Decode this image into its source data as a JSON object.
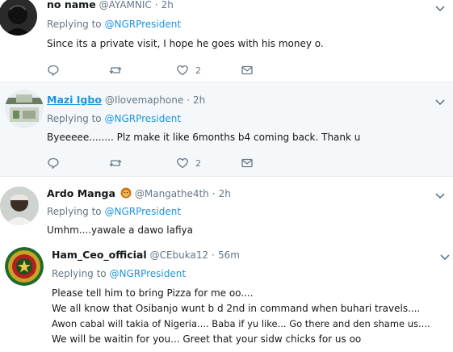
{
  "tweets": [
    {
      "name": "no name",
      "handle": "@AYAMNIC",
      "separator": "·",
      "time": "2h",
      "replying_label": "Replying to",
      "replying_handle": "@NGRPresident",
      "text": [
        "Since its a private visit, I hope he goes with his money o."
      ],
      "likes": "2"
    },
    {
      "name": "Mazi Igbo",
      "handle": "@Ilovemaphone",
      "separator": "·",
      "time": "2h",
      "replying_label": "Replying to",
      "replying_handle": "@NGRPresident",
      "text": [
        "Byeeeee........ Plz make it like 6months b4 coming back. Thank u"
      ],
      "likes": "2"
    },
    {
      "name": "Ardo Manga",
      "emoji": "lion-face-icon",
      "handle": "@Mangathe4th",
      "separator": "·",
      "time": "2h",
      "replying_label": "Replying to",
      "replying_handle": "@NGRPresident",
      "text": [
        "Umhm....yawale a dawo lafiya"
      ]
    },
    {
      "name": "Ham_Ceo_official",
      "handle": "@CEbuka12",
      "separator": "·",
      "time": "56m",
      "replying_label": "Replying to",
      "replying_handle": "@NGRPresident",
      "text": [
        "Please tell him to bring Pizza for me oo....",
        "We all know that Osibanjo wunt b d 2nd in command when buhari travels....",
        "Awon cabal will takia of Nigeria.... Baba if yu like... Go there and den shame us....",
        "We will be waitin for you... Greet that your sidw chicks for us oo"
      ],
      "avatar_lettering": "NIGERIAN ARMY"
    }
  ],
  "icons": {
    "reply": "reply-icon",
    "retweet": "retweet-icon",
    "like": "heart-icon",
    "dm": "envelope-icon",
    "menu": "chevron-down-icon"
  },
  "colors": {
    "link": "#1b95e0",
    "secondary": "#657786",
    "highlight_bg": "#f5f8fa",
    "divider": "#e6ecf0"
  }
}
